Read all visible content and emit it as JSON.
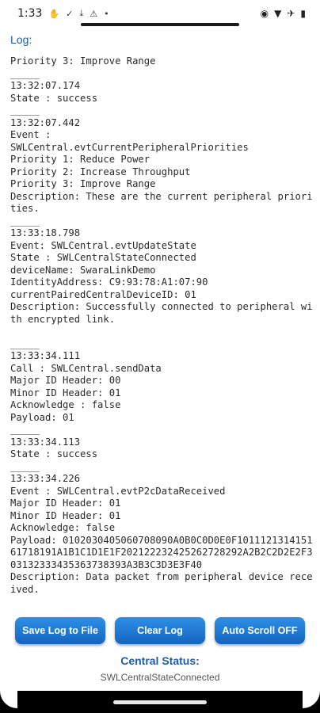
{
  "status_bar": {
    "time": "1:33",
    "left_icons": [
      "hand-icon",
      "checkmark-icon",
      "download-icon",
      "alert-icon",
      "dot-icon"
    ],
    "right_icons": [
      "eye-icon",
      "wifi-icon",
      "airplane-icon",
      "battery-icon"
    ]
  },
  "log": {
    "header": "Log:",
    "text": "Priority 3: Improve Range\n_____\n13:32:07.174\nState : success\n_____\n13:32:07.442\nEvent :\nSWLCentral.evtCurrentPeripheralPriorities\nPriority 1: Reduce Power\nPriority 2: Increase Throughput\nPriority 3: Improve Range\nDescription: These are the current peripheral priorities.\n_____\n13:33:18.798\nEvent: SWLCentral.evtUpdateState\nState : SWLCentralStateConnected\ndeviceName: SwaraLinkDemo\nIdentityAddress: C9:93:78:A1:07:90\ncurrentPairedCentralDeviceID: 01\nDescription: Successfully connected to peripheral with encrypted link.\n\n_____\n13:33:34.111\nCall : SWLCentral.sendData\nMajor ID Header: 00\nMinor ID Header: 01\nAcknowledge : false\nPayload: 01\n_____\n13:33:34.113\nState : success\n_____\n13:33:34.226\nEvent : SWLCentral.evtP2cDataReceived\nMajor ID Header: 01\nMinor ID Header: 01\nAcknowledge: false\nPayload: 0102030405060708090A0B0C0D0E0F101112131415161718191A1B1C1D1E1F202122232425262728292A2B2C2D2E2F303132333435363738393A3B3C3D3E3F40\nDescription: Data packet from peripheral device received."
  },
  "buttons": {
    "save": "Save Log to File",
    "clear": "Clear Log",
    "autoscroll": "Auto Scroll OFF"
  },
  "central": {
    "label": "Central Status:",
    "value": "SWLCentralStateConnected"
  },
  "colors": {
    "accent": "#1e5ba8",
    "button": "#1e78d6"
  }
}
